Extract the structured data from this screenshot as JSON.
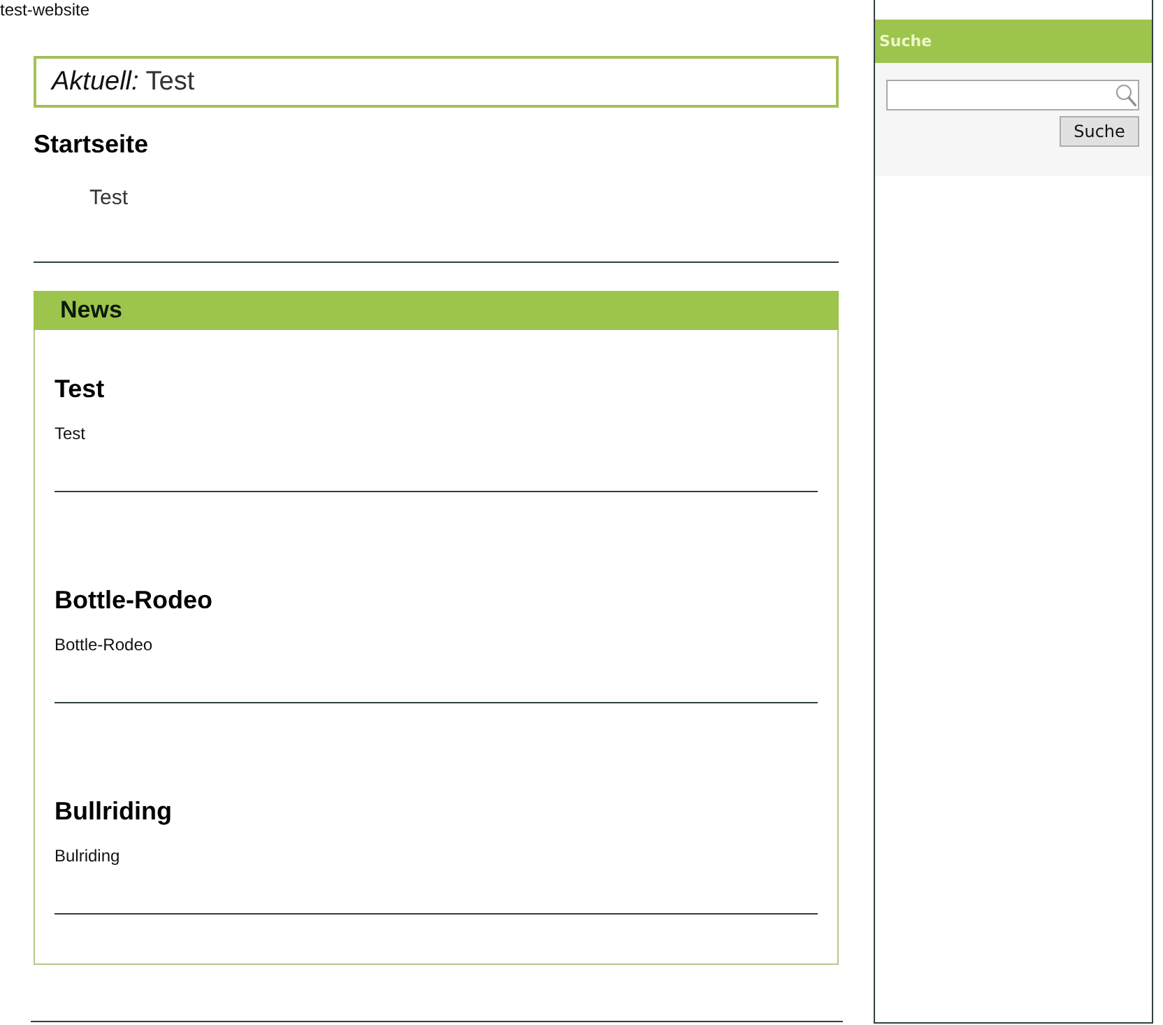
{
  "site_title": "test-website",
  "current": {
    "label": "Aktuell:",
    "value": "Test"
  },
  "page": {
    "heading": "Startseite",
    "text": "Test"
  },
  "news": {
    "title": "News",
    "items": [
      {
        "title": "Test",
        "text": "Test"
      },
      {
        "title": "Bottle-Rodeo",
        "text": "Bottle-Rodeo"
      },
      {
        "title": "Bullriding",
        "text": "Bulriding"
      }
    ]
  },
  "sidebar": {
    "title": "Suche",
    "button": "Suche"
  }
}
